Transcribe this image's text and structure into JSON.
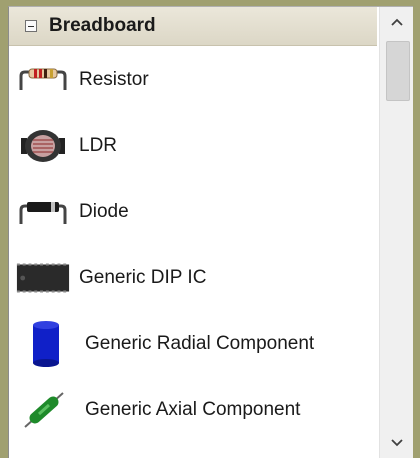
{
  "section": {
    "title": "Breadboard"
  },
  "items": [
    {
      "label": "Resistor",
      "icon": "resistor-icon"
    },
    {
      "label": "LDR",
      "icon": "ldr-icon"
    },
    {
      "label": "Diode",
      "icon": "diode-icon"
    },
    {
      "label": "Generic DIP IC",
      "icon": "dip-ic-icon"
    },
    {
      "label": "Generic Radial Component",
      "icon": "radial-capacitor-icon"
    },
    {
      "label": "Generic Axial Component",
      "icon": "axial-component-icon"
    }
  ],
  "colors": {
    "header_bg": "#dcd7c6",
    "window_frame": "#a0a070",
    "radial_blue": "#1020c8",
    "axial_green": "#1e8a2a"
  }
}
